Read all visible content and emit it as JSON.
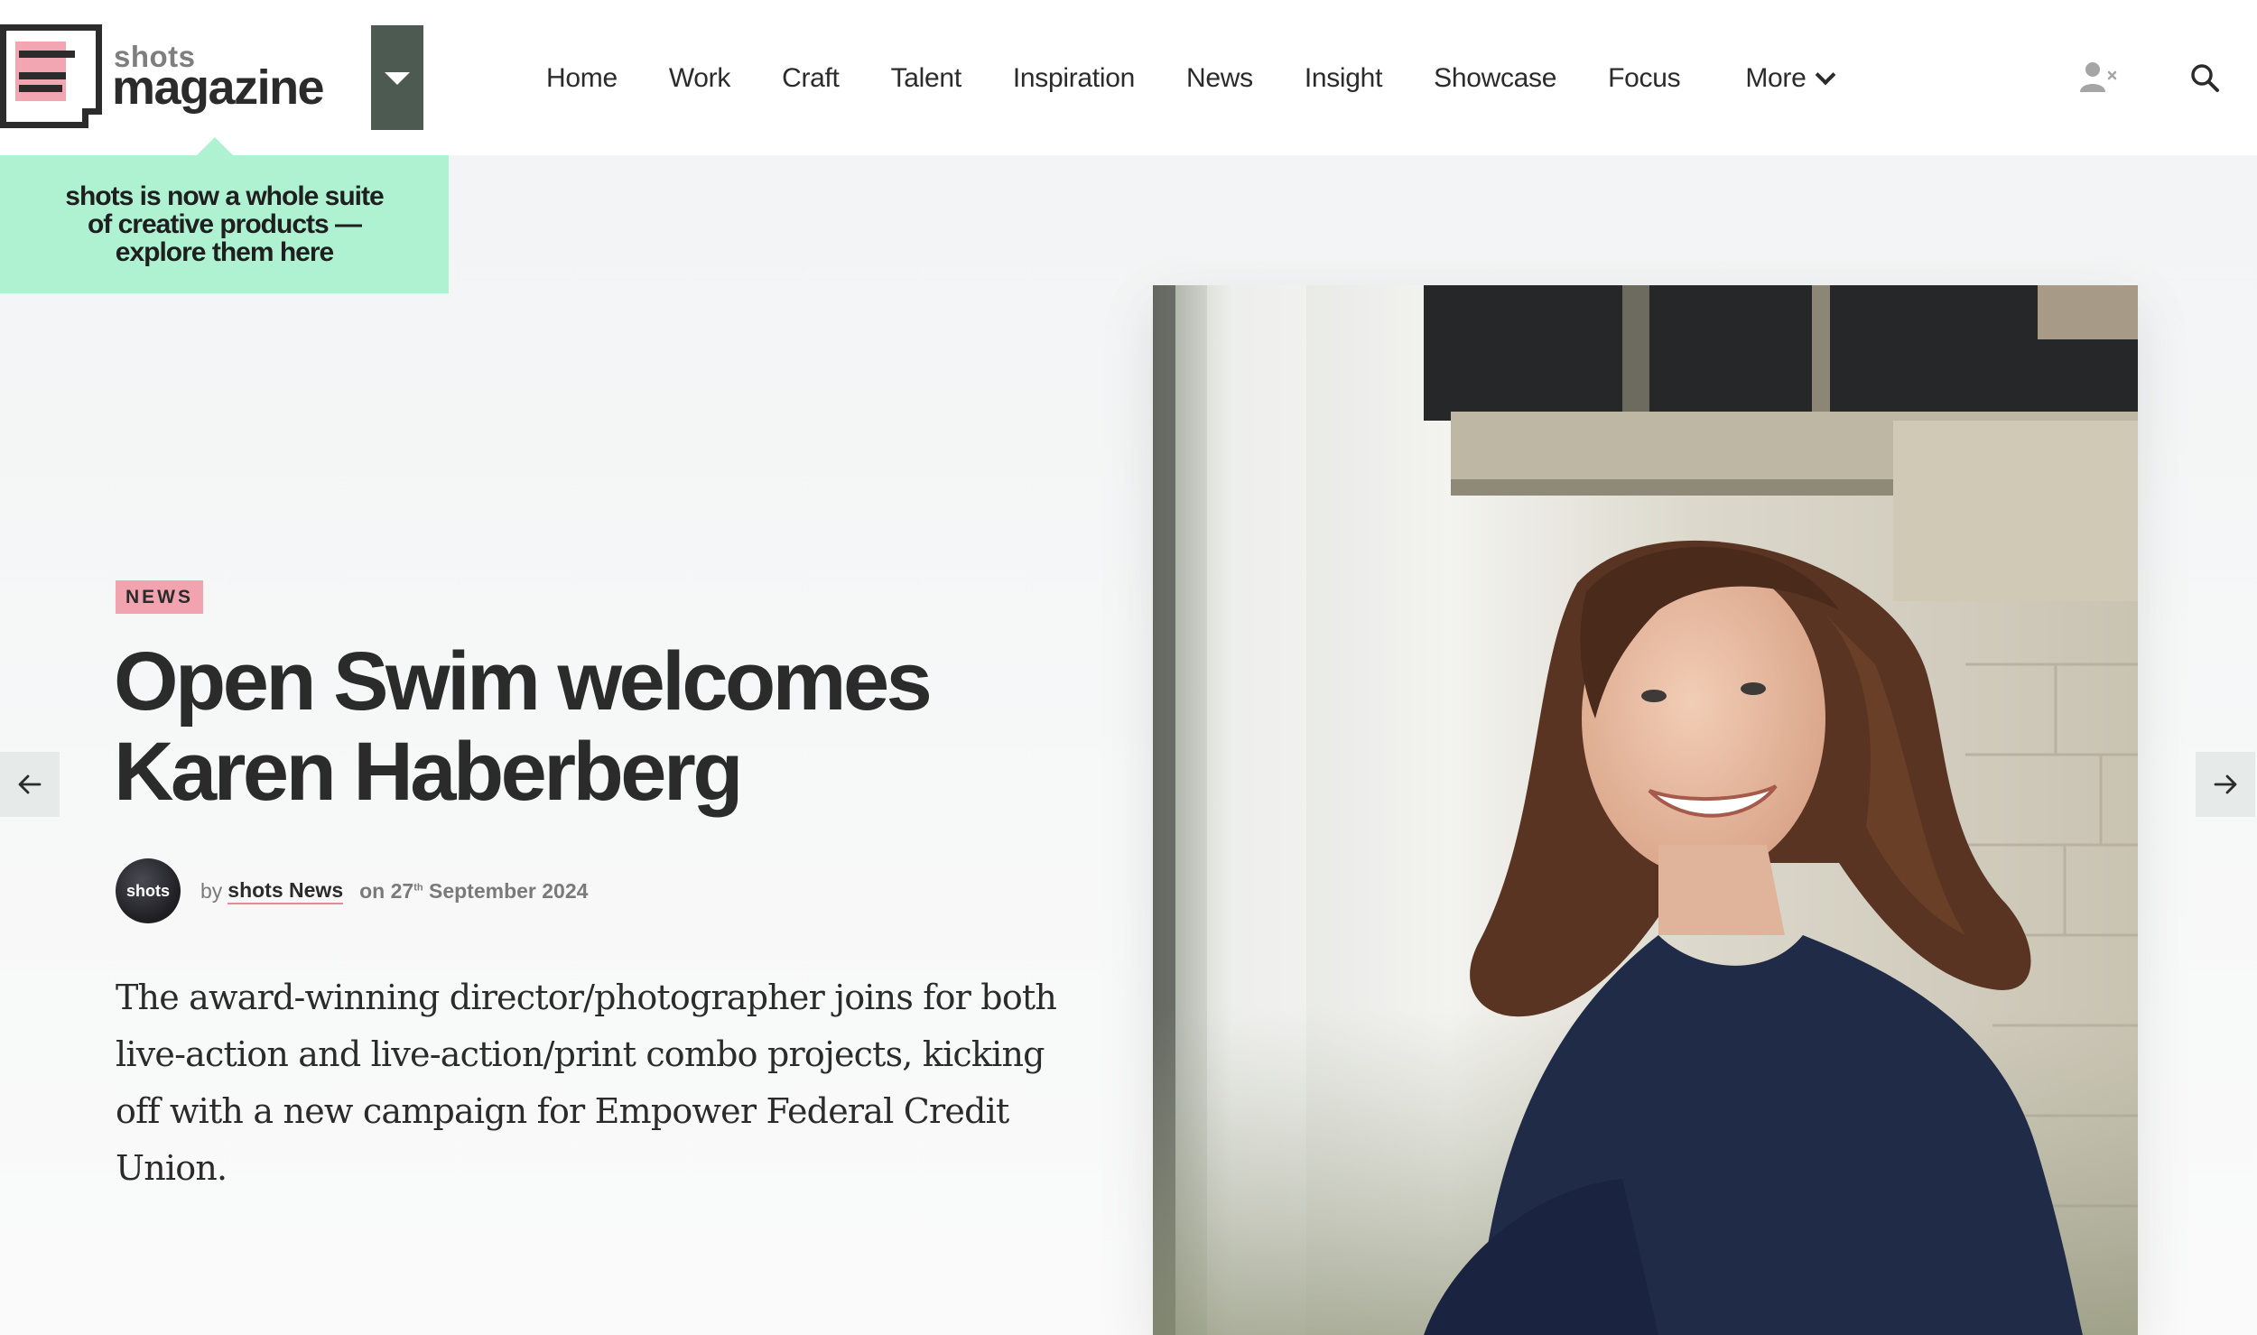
{
  "brand": {
    "small": "shots",
    "big": "magazine",
    "promo": "shots is now a whole suite of creative products — explore them here"
  },
  "nav": {
    "items": [
      "Home",
      "Work",
      "Craft",
      "Talent",
      "Inspiration",
      "News",
      "Insight",
      "Showcase",
      "Focus"
    ],
    "more_label": "More"
  },
  "icons": {
    "user": "user-logged-out-icon",
    "search": "search-icon",
    "prev": "arrow-left-icon",
    "next": "arrow-right-icon",
    "menu_toggle": "caret-down-icon"
  },
  "article": {
    "tag": "NEWS",
    "headline_line1": "Open Swim welcomes",
    "headline_line2": "Karen Haberberg",
    "avatar_text": "shots",
    "by_prefix": "by",
    "author": "shots News",
    "date_prefix": "on 27",
    "date_suffix": "th",
    "date_rest": " September 2024",
    "standfirst": "The award-winning director/photographer joins for both live-action and live-action/print combo projects, kicking off with a new campaign for Empower Federal Credit Union."
  },
  "colors": {
    "promo_bg": "#aef2d2",
    "tag_bg": "#f1a4b0",
    "toggle_bg": "#4d5a52",
    "logo_pink": "#f2a6b2"
  }
}
